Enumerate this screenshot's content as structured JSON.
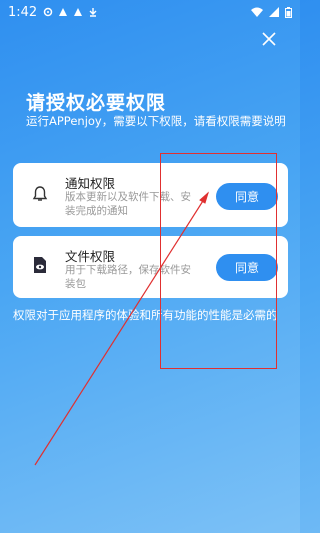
{
  "status_bar": {
    "time": "1:42",
    "icons_left": [
      "settings-icon",
      "a-icon",
      "a-icon",
      "download-icon"
    ],
    "icons_right": [
      "wifi-icon",
      "signal-icon",
      "battery-icon"
    ]
  },
  "header": {
    "title": "请授权必要权限",
    "subtitle": "运行APPenjoy，需要以下权限，请看权限需要说明"
  },
  "permissions": [
    {
      "title": "通知权限",
      "description": "版本更新以及软件下载、安装完成的通知",
      "button": "同意",
      "icon": "bell-icon"
    },
    {
      "title": "文件权限",
      "description": "用于下载路径，保存软件安装包",
      "button": "同意",
      "icon": "file-eye-icon"
    }
  ],
  "footer_note": "权限对于应用程序的体验和所有功能的性能是必需的",
  "colors": {
    "accent": "#2f8ff0",
    "annotation": "#e03030"
  }
}
